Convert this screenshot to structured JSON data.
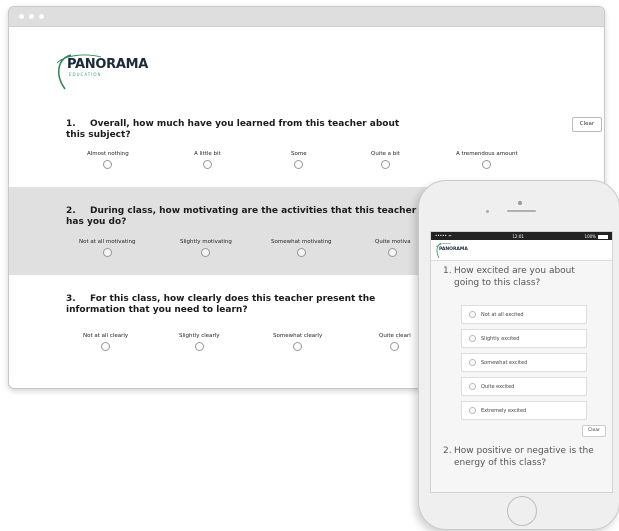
{
  "logo": {
    "name": "PANORAMA",
    "sub": "EDUCATION"
  },
  "desktop": {
    "clear_label": "Clear",
    "questions": [
      {
        "number": "1.",
        "text": "Overall, how much have you learned from this teacher about this subject?",
        "options": [
          "Almost nothing",
          "A little bit",
          "Some",
          "Quite a bit",
          "A tremendous amount"
        ]
      },
      {
        "number": "2.",
        "text": "During class, how motivating are the activities that this teacher has you do?",
        "options": [
          "Not at all motivating",
          "Slightly motivating",
          "Somewhat motivating",
          "Quite motiva"
        ]
      },
      {
        "number": "3.",
        "text": "For this class, how clearly does this teacher present the information that you need to learn?",
        "options": [
          "Not at all clearly",
          "Slightly clearly",
          "Somewhat clearly",
          "Quite clearl"
        ]
      }
    ]
  },
  "phone": {
    "status": {
      "signal": "•••••",
      "wifi": "ᯤ",
      "time": "12:01",
      "battery": "100%"
    },
    "logo": "PANORAMA",
    "question1": {
      "number": "1.",
      "text": "How excited are you about going to this class?"
    },
    "options": [
      "Not at all excited",
      "Slightly excited",
      "Somewhat excited",
      "Quite excited",
      "Extremely excited"
    ],
    "clear_label": "Clear",
    "question2": {
      "number": "2.",
      "text": "How positive or negative is the energy of this class?"
    }
  }
}
